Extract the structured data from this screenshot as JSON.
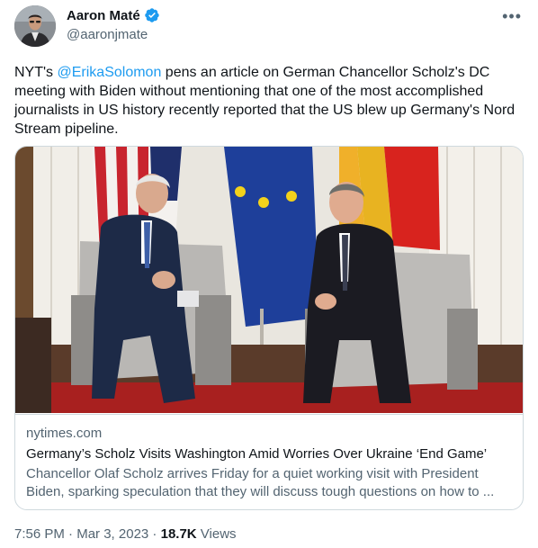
{
  "author": {
    "name": "Aaron Maté",
    "handle": "@aaronjmate",
    "verified_icon": "verified-badge-icon",
    "avatar_icon": "avatar"
  },
  "menu_icon": "more-options-icon",
  "more_glyph": "•••",
  "tweet": {
    "text_before": "NYT's ",
    "mention": "@ErikaSolomon",
    "text_after": " pens an article on German Chancellor Scholz's DC meeting with Biden without mentioning that one of the most accomplished journalists in US history recently reported that the US blew up Germany's Nord Stream pipeline."
  },
  "card": {
    "domain": "nytimes.com",
    "headline": "Germany’s Scholz Visits Washington Amid Worries Over Ukraine ‘End Game’",
    "description": "Chancellor Olaf Scholz arrives Friday for a quiet working visit with President Biden, sparking speculation that they will discuss tough questions on how to ..."
  },
  "meta": {
    "time": "7:56 PM",
    "sep1": " · ",
    "date": "Mar 3, 2023",
    "sep2": " · ",
    "views_count": "18.7K",
    "views_label": " Views"
  },
  "colors": {
    "link": "#1d9bf0",
    "secondary_text": "#536471",
    "border": "#cfd9de"
  }
}
